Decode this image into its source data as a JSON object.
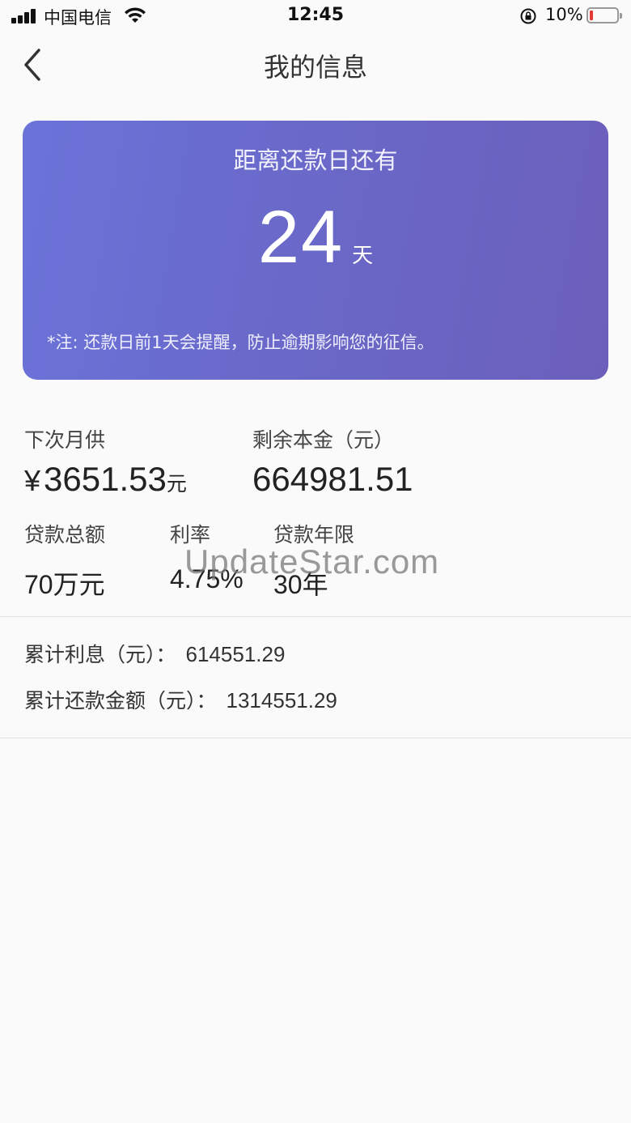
{
  "status_bar": {
    "carrier": "中国电信",
    "time": "12:45",
    "battery_percent": "10%",
    "battery_level": 0.1,
    "icons": [
      "signal-icon",
      "wifi-icon",
      "rotation-lock-icon",
      "battery-icon"
    ]
  },
  "nav": {
    "title": "我的信息",
    "back_icon": "chevron-left-icon"
  },
  "card": {
    "title": "距离还款日还有",
    "days": "24",
    "days_unit": "天",
    "note": "*注: 还款日前1天会提醒，防止逾期影响您的征信。",
    "gradient_start": "#6b73d9",
    "gradient_end": "#6b5fbb"
  },
  "summary": {
    "next_payment_label": "下次月供",
    "next_payment_currency": "¥",
    "next_payment_value": "3651.53",
    "next_payment_unit": "元",
    "remaining_principal_label": "剩余本金（元）",
    "remaining_principal_value": "664981.51",
    "loan_total_label": "贷款总额",
    "loan_total_value": "70万元",
    "rate_label": "利率",
    "rate_value": "4.75%",
    "term_label": "贷款年限",
    "term_value": "30年"
  },
  "totals": {
    "interest_label": "累计利息（元）：",
    "interest_value": "614551.29",
    "repayment_label": "累计还款金额（元）：",
    "repayment_value": "1314551.29"
  },
  "watermark": "UpdateStar.com"
}
